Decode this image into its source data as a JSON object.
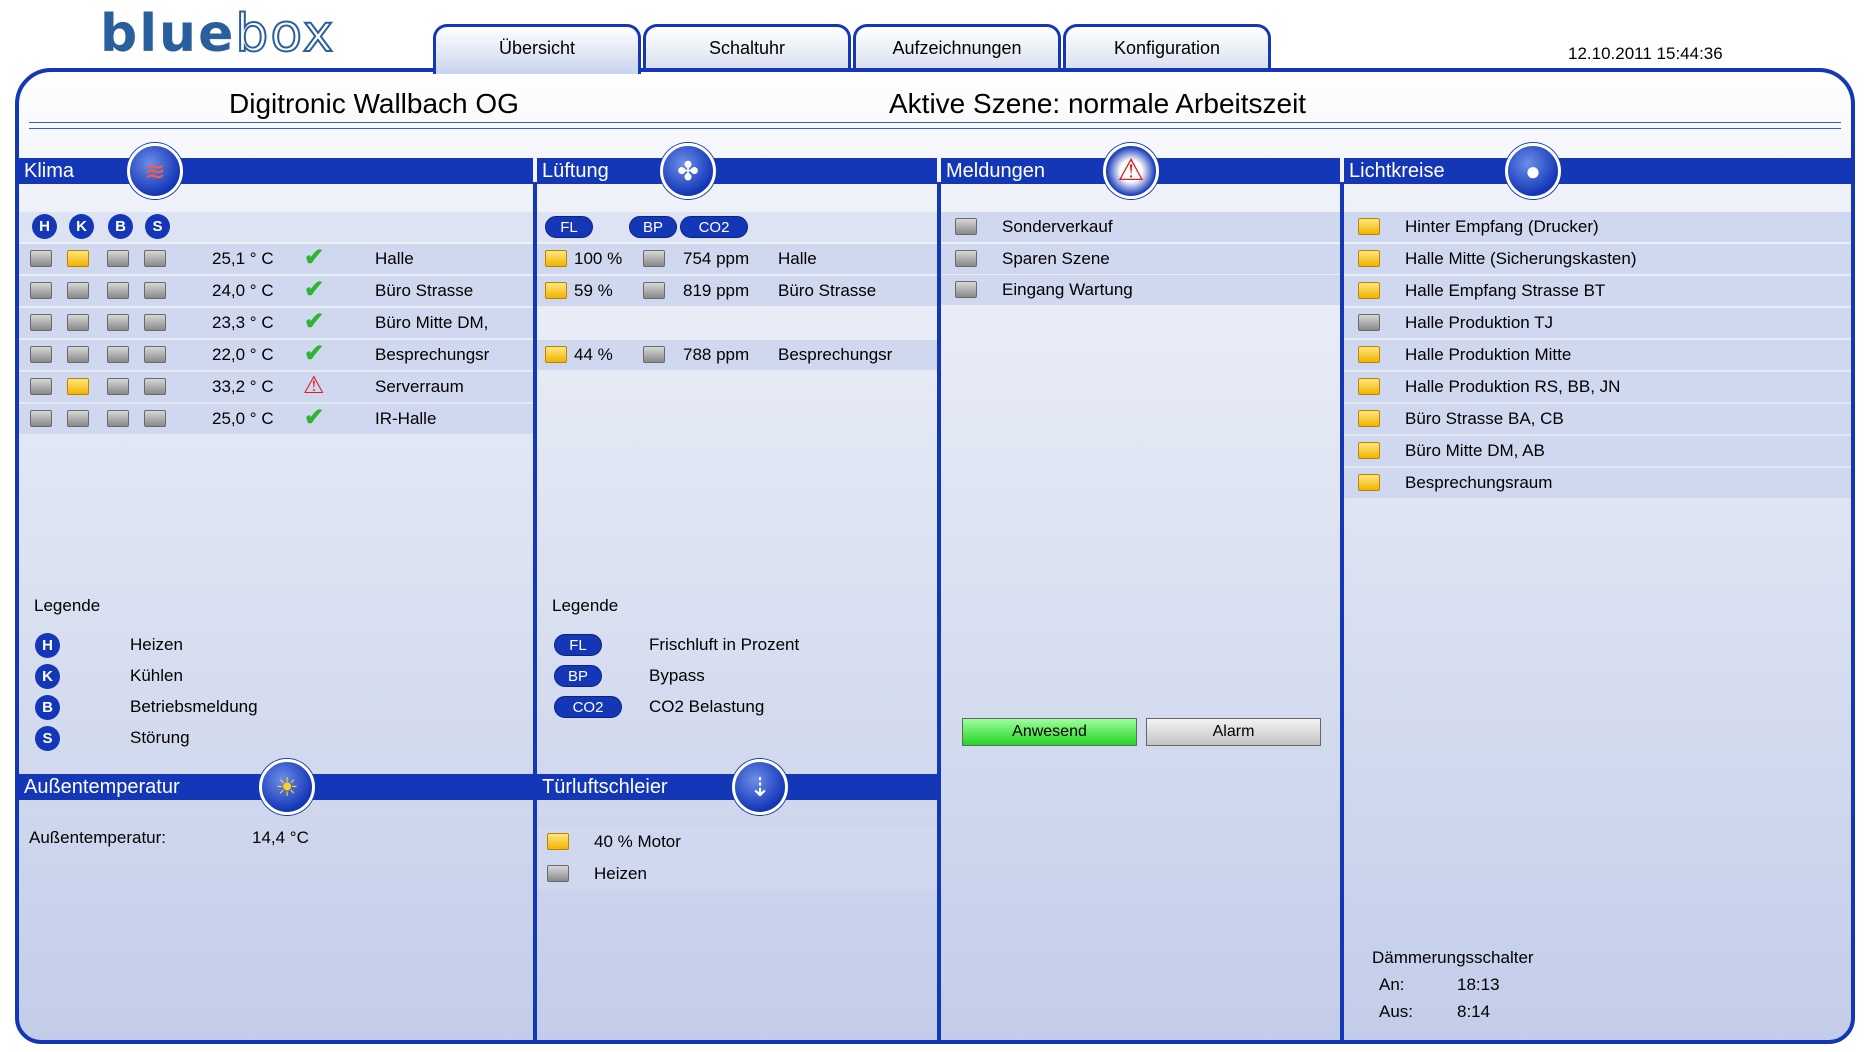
{
  "logo": {
    "part1": "blue",
    "part2": "box"
  },
  "tabs": [
    {
      "label": "Übersicht",
      "active": true
    },
    {
      "label": "Schaltuhr",
      "active": false
    },
    {
      "label": "Aufzeichnungen",
      "active": false
    },
    {
      "label": "Konfiguration",
      "active": false
    }
  ],
  "datetime": "12.10.2011 15:44:36",
  "company": "Digitronic Wallbach OG",
  "scene": "Aktive Szene: normale Arbeitszeit",
  "klima": {
    "title": "Klima",
    "header_badges": [
      "H",
      "K",
      "B",
      "S"
    ],
    "rows": [
      {
        "leds": [
          false,
          true,
          false,
          false
        ],
        "temp": "25,1 ° C",
        "status": "ok",
        "room": "Halle"
      },
      {
        "leds": [
          false,
          false,
          false,
          false
        ],
        "temp": "24,0 ° C",
        "status": "ok",
        "room": "Büro Strasse"
      },
      {
        "leds": [
          false,
          false,
          false,
          false
        ],
        "temp": "23,3 ° C",
        "status": "ok",
        "room": "Büro Mitte DM,"
      },
      {
        "leds": [
          false,
          false,
          false,
          false
        ],
        "temp": "22,0 ° C",
        "status": "ok",
        "room": "Besprechungsr"
      },
      {
        "leds": [
          false,
          true,
          false,
          false
        ],
        "temp": "33,2 ° C",
        "status": "warn",
        "room": "Serverraum"
      },
      {
        "leds": [
          false,
          false,
          false,
          false
        ],
        "temp": "25,0 ° C",
        "status": "ok",
        "room": "IR-Halle"
      }
    ],
    "legend_title": "Legende",
    "legend": [
      {
        "badge": "H",
        "text": "Heizen"
      },
      {
        "badge": "K",
        "text": "Kühlen"
      },
      {
        "badge": "B",
        "text": "Betriebsmeldung"
      },
      {
        "badge": "S",
        "text": "Störung"
      }
    ]
  },
  "lueftung": {
    "title": "Lüftung",
    "header_badges": [
      "FL",
      "BP",
      "CO2"
    ],
    "rows": [
      {
        "fl": "100 %",
        "co2": "754 ppm",
        "room": "Halle"
      },
      {
        "fl": "59 %",
        "co2": "819 ppm",
        "room": "Büro Strasse"
      },
      {
        "fl": "",
        "co2": "",
        "room": ""
      },
      {
        "fl": "44 %",
        "co2": "788 ppm",
        "room": "Besprechungsr"
      }
    ],
    "legend_title": "Legende",
    "legend": [
      {
        "badge": "FL",
        "text": "Frischluft in Prozent"
      },
      {
        "badge": "BP",
        "text": "Bypass"
      },
      {
        "badge": "CO2",
        "text": "CO2 Belastung"
      }
    ]
  },
  "meldungen": {
    "title": "Meldungen",
    "items": [
      "Sonderverkauf",
      "Sparen Szene",
      "Eingang Wartung"
    ],
    "btn_anwesend": "Anwesend",
    "btn_alarm": "Alarm"
  },
  "lichtkreise": {
    "title": "Lichtkreise",
    "items": [
      {
        "label": "Hinter Empfang (Drucker)",
        "on": true
      },
      {
        "label": "Halle Mitte (Sicherungskasten)",
        "on": true
      },
      {
        "label": "Halle Empfang Strasse BT",
        "on": true
      },
      {
        "label": "Halle Produktion TJ",
        "on": false
      },
      {
        "label": "Halle Produktion Mitte",
        "on": true
      },
      {
        "label": "Halle Produktion RS, BB, JN",
        "on": true
      },
      {
        "label": "Büro Strasse BA, CB",
        "on": true
      },
      {
        "label": "Büro Mitte DM, AB",
        "on": true
      },
      {
        "label": "Besprechungsraum",
        "on": true
      }
    ],
    "daemmerung_title": "Dämmerungsschalter",
    "an_label": "An:",
    "an_value": "18:13",
    "aus_label": "Aus:",
    "aus_value": "8:14"
  },
  "aussen": {
    "title": "Außentemperatur",
    "label": "Außentemperatur:",
    "value": "14,4 °C"
  },
  "tuer": {
    "title": "Türluftschleier",
    "items": [
      {
        "label": "40 % Motor",
        "on": true
      },
      {
        "label": "Heizen",
        "on": false
      }
    ]
  },
  "colors": {
    "accent": "#1437b8",
    "led_on": "#f2b300",
    "led_off": "#9a9a9a",
    "ok": "#2db52d",
    "warn": "#e21d1d"
  },
  "icons": {
    "klima": "heat-waves-icon",
    "lueftung": "fan-icon",
    "meldungen": "warning-triangle-icon",
    "lichtkreise": "light-bulb-icon",
    "aussen": "sun-icon",
    "tuer": "air-curtain-icon"
  }
}
